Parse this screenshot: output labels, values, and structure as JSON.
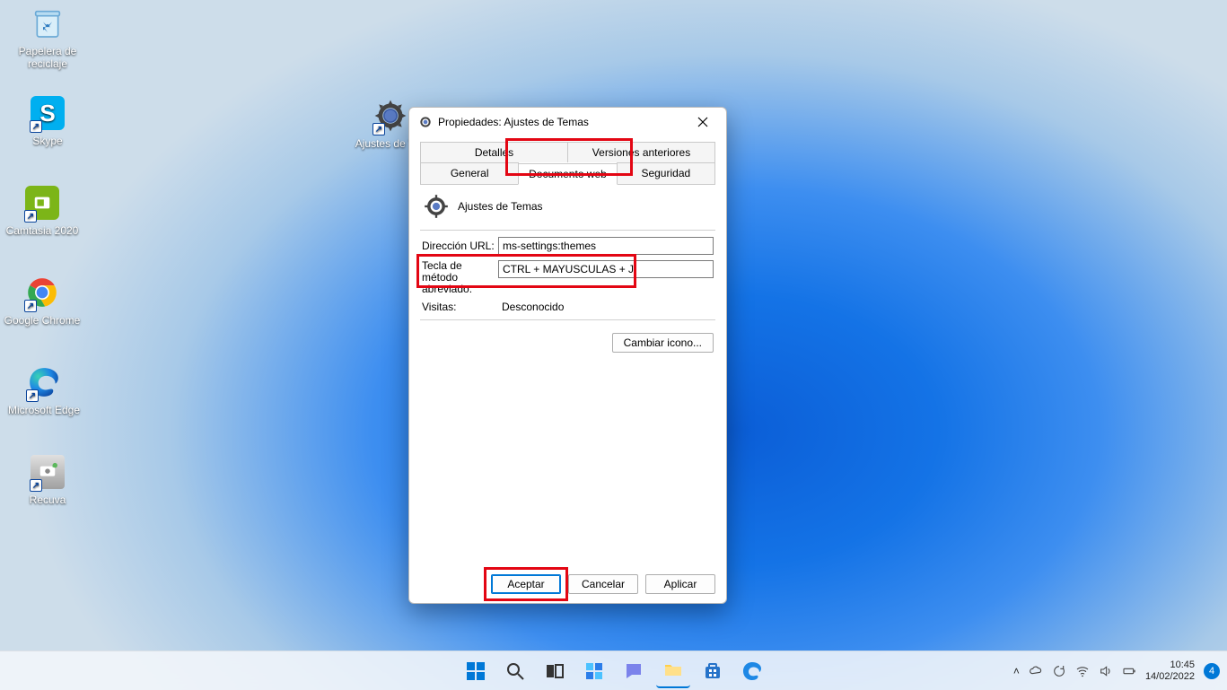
{
  "desktop": {
    "icons": [
      {
        "id": "recycle-bin",
        "label": "Papelera de reciclaje"
      },
      {
        "id": "skype",
        "label": "Skype"
      },
      {
        "id": "camtasia",
        "label": "Camtasia 2020"
      },
      {
        "id": "chrome",
        "label": "Google Chrome"
      },
      {
        "id": "edge",
        "label": "Microsoft Edge"
      },
      {
        "id": "recuva",
        "label": "Recuva"
      },
      {
        "id": "themes-shortcut",
        "label": "Ajustes de T…"
      }
    ]
  },
  "dialog": {
    "title_prefix": "Propiedades: ",
    "title_subject": "Ajustes de Temas",
    "tabs_row1": [
      "Detalles",
      "Versiones anteriores"
    ],
    "tabs_row2": [
      "General",
      "Documento web",
      "Seguridad"
    ],
    "active_tab": "Documento web",
    "header_label": "Ajustes de Temas",
    "url_label": "Dirección URL:",
    "url_value": "ms-settings:themes",
    "shortcut_label_line1": "Tecla de método",
    "shortcut_label_line2": "abreviado:",
    "shortcut_value": "CTRL + MAYUSCULAS + J",
    "visits_label": "Visitas:",
    "visits_value": "Desconocido",
    "change_icon_label": "Cambiar icono...",
    "buttons": {
      "ok": "Aceptar",
      "cancel": "Cancelar",
      "apply": "Aplicar"
    }
  },
  "taskbar": {
    "time": "10:45",
    "date": "14/02/2022",
    "notif_count": "4"
  }
}
